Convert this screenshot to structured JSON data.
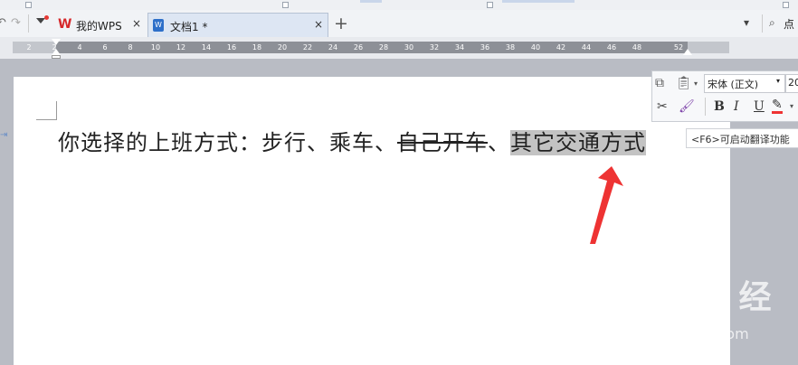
{
  "tabs": [
    {
      "label": "我的WPS",
      "close": "×"
    },
    {
      "label": "文档1 *",
      "close": "×"
    }
  ],
  "new_tab": "+",
  "right_toolbar": {
    "search_label": "点"
  },
  "ruler": {
    "ticks": [
      "2",
      "2",
      "4",
      "6",
      "8",
      "10",
      "12",
      "14",
      "16",
      "18",
      "20",
      "22",
      "24",
      "26",
      "28",
      "30",
      "32",
      "34",
      "36",
      "38",
      "40",
      "42",
      "44",
      "46",
      "48",
      "52"
    ]
  },
  "document": {
    "text_before": "你选择的上班方式：步行、乘车、",
    "strikethrough_text": "自己开车",
    "separator": "、",
    "selected_text": "其它交通方式"
  },
  "mini_toolbar": {
    "font_name": "宋体 (正文)",
    "font_size": "20",
    "bold": "B",
    "italic": "I",
    "underline": "U"
  },
  "tooltip": "<F6>可启动翻译功能",
  "watermark": {
    "logo": "Bai du 经验",
    "url": "jingyan.baidu.com"
  },
  "colors": {
    "accent_red": "#ee3333",
    "selection": "#c3c3c3",
    "ruler_active": "#8d9097"
  }
}
